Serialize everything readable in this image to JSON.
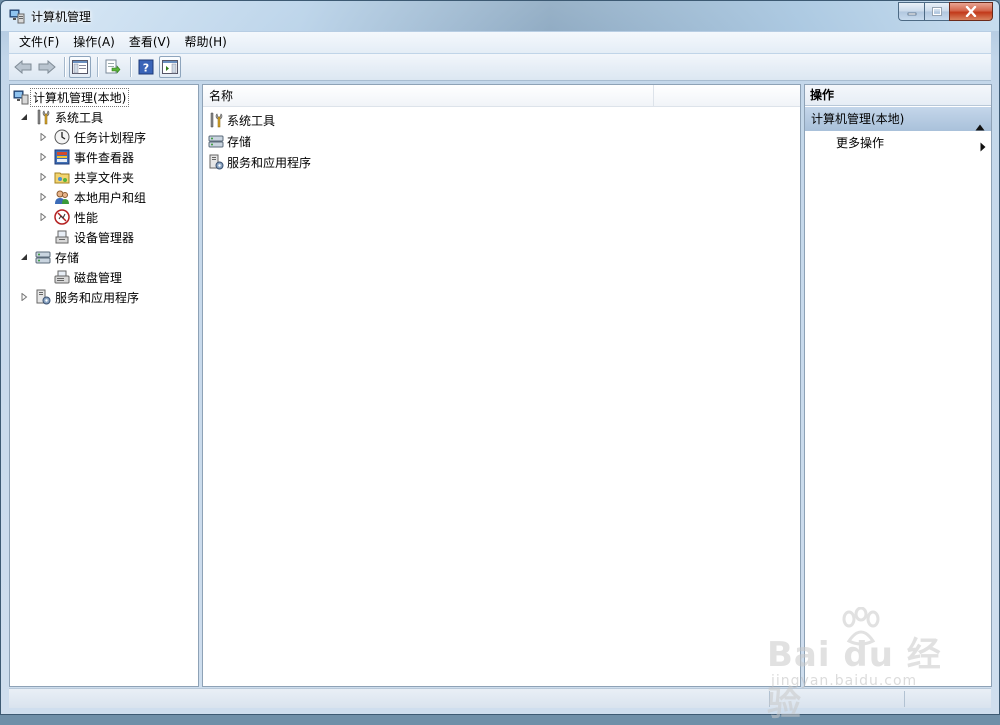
{
  "window": {
    "title": "计算机管理",
    "controls": {
      "minimize": "minimize",
      "maximize": "maximize",
      "close": "close"
    }
  },
  "menubar": {
    "items": [
      {
        "label": "文件(F)"
      },
      {
        "label": "操作(A)"
      },
      {
        "label": "查看(V)"
      },
      {
        "label": "帮助(H)"
      }
    ]
  },
  "toolbar": {
    "buttons": [
      "back-arrow-icon",
      "forward-arrow-icon",
      "show-hide-tree-icon",
      "export-list-icon",
      "help-icon",
      "show-hide-action-pane-icon"
    ]
  },
  "tree": {
    "items": [
      {
        "label": "计算机管理(本地)",
        "icon": "computer-management-icon",
        "expander": "none",
        "selected": true
      },
      {
        "label": "系统工具",
        "icon": "system-tools-icon",
        "expander": "expanded"
      },
      {
        "label": "任务计划程序",
        "icon": "task-scheduler-icon",
        "expander": "collapsed"
      },
      {
        "label": "事件查看器",
        "icon": "event-viewer-icon",
        "expander": "collapsed"
      },
      {
        "label": "共享文件夹",
        "icon": "shared-folders-icon",
        "expander": "collapsed"
      },
      {
        "label": "本地用户和组",
        "icon": "local-users-icon",
        "expander": "collapsed"
      },
      {
        "label": "性能",
        "icon": "performance-icon",
        "expander": "collapsed"
      },
      {
        "label": "设备管理器",
        "icon": "device-manager-icon",
        "expander": "none"
      },
      {
        "label": "存储",
        "icon": "storage-icon",
        "expander": "expanded"
      },
      {
        "label": "磁盘管理",
        "icon": "disk-management-icon",
        "expander": "none"
      },
      {
        "label": "服务和应用程序",
        "icon": "services-apps-icon",
        "expander": "collapsed"
      }
    ]
  },
  "list": {
    "column_name": "名称",
    "rows": [
      {
        "label": "系统工具",
        "icon": "system-tools-icon"
      },
      {
        "label": "存储",
        "icon": "storage-icon"
      },
      {
        "label": "服务和应用程序",
        "icon": "services-apps-icon"
      }
    ]
  },
  "actions": {
    "header": "操作",
    "group_label": "计算机管理(本地)",
    "more_actions": "更多操作"
  },
  "watermark": {
    "brand": "Bai du 经验",
    "url": "jingyan.baidu.com"
  }
}
